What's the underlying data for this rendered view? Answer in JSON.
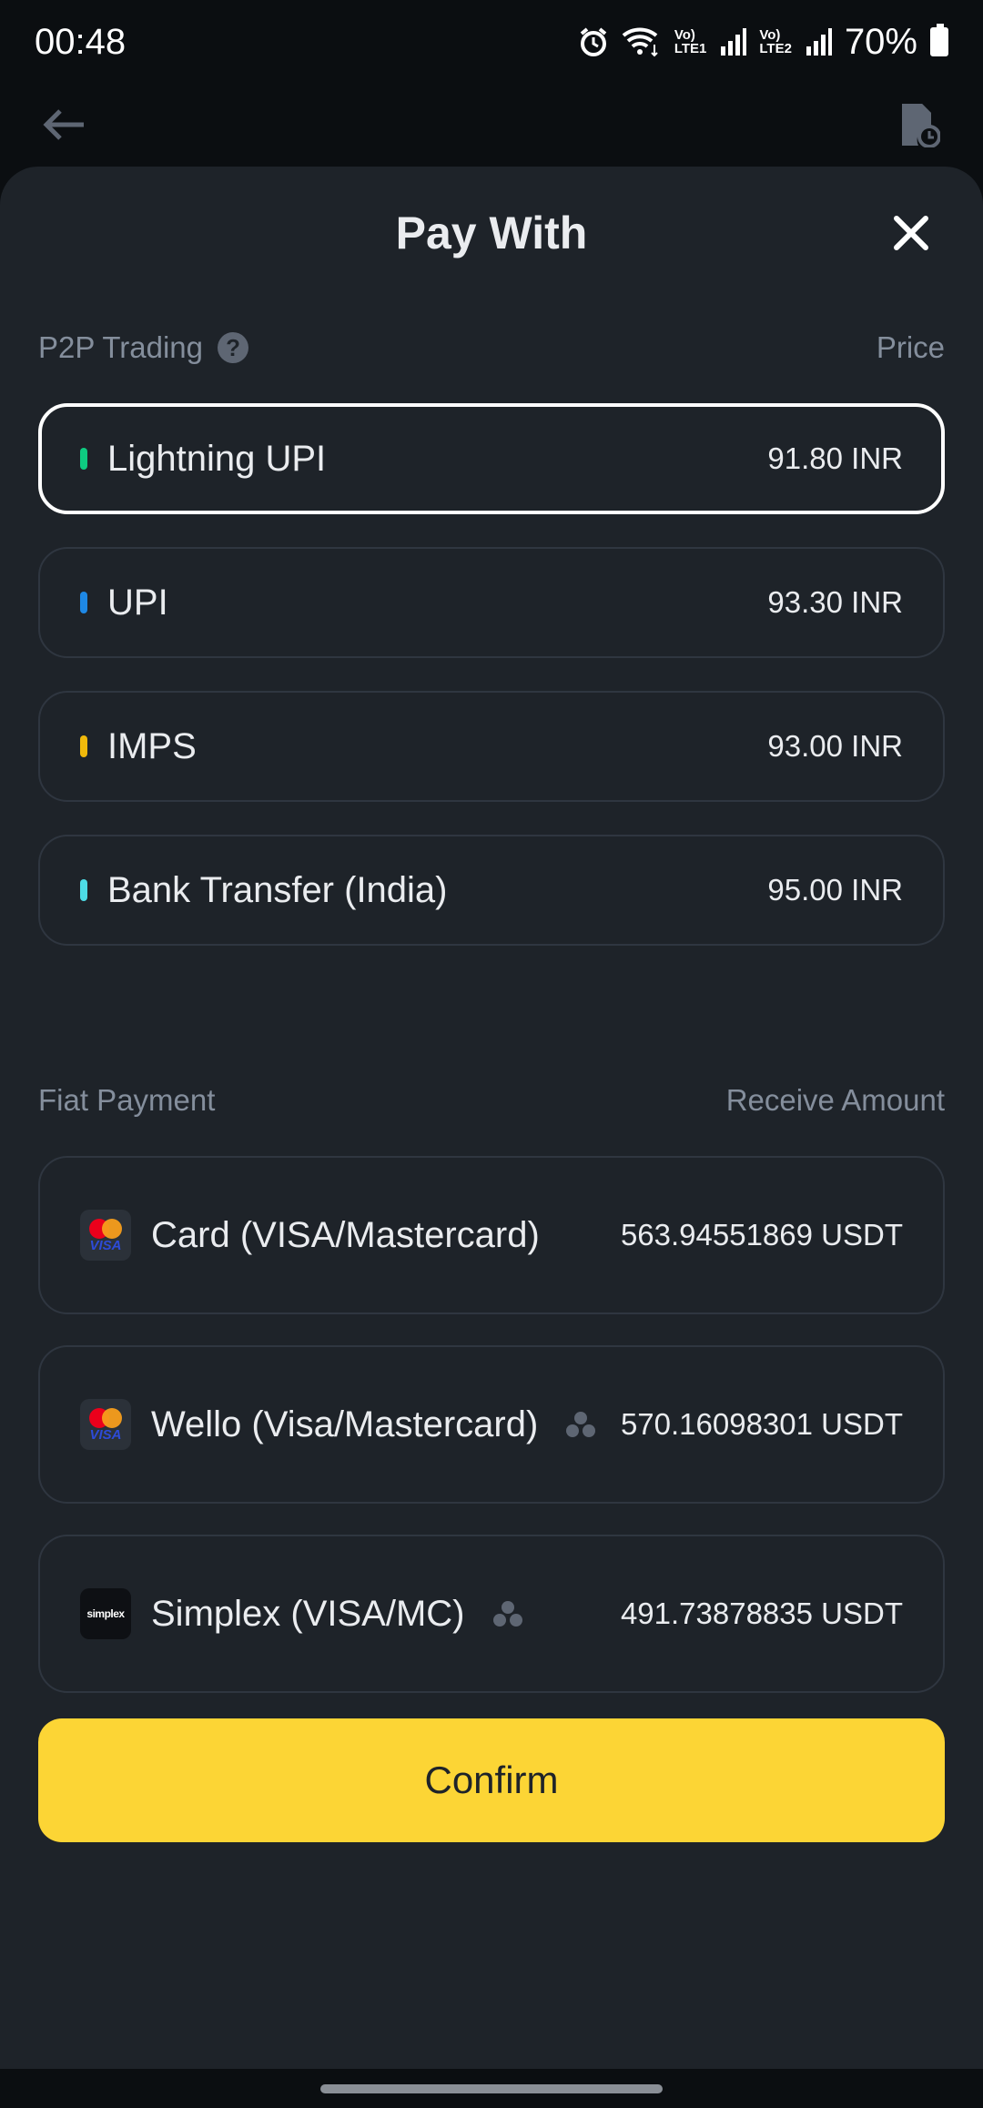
{
  "status_bar": {
    "time": "00:48",
    "net1": "Vo)\nLTE1",
    "net2": "Vo)\nLTE2",
    "battery": "70%",
    "icons": [
      "alarm-icon",
      "wifi-icon",
      "signal-icon",
      "battery-icon"
    ]
  },
  "sheet": {
    "title": "Pay With"
  },
  "p2p": {
    "label": "P2P Trading",
    "column_label": "Price",
    "options": [
      {
        "name": "Lightning UPI",
        "value": "91.80 INR",
        "color": "#0ecb81",
        "selected": true
      },
      {
        "name": "UPI",
        "value": "93.30 INR",
        "color": "#1e88e5",
        "selected": false
      },
      {
        "name": "IMPS",
        "value": "93.00 INR",
        "color": "#f0b90b",
        "selected": false
      },
      {
        "name": "Bank Transfer (India)",
        "value": "95.00 INR",
        "color": "#4ddce6",
        "selected": false
      }
    ]
  },
  "fiat": {
    "label": "Fiat Payment",
    "column_label": "Receive Amount",
    "options": [
      {
        "name": "Card (VISA/Mastercard)",
        "value": "563.94551869 USDT",
        "logo": "visa-mastercard"
      },
      {
        "name": "Wello (Visa/Mastercard)",
        "value": "570.16098301 USDT",
        "logo": "visa-mastercard"
      },
      {
        "name": "Simplex (VISA/MC)",
        "value": "491.73878835 USDT",
        "logo": "simplex",
        "logo_text": "simplex"
      }
    ],
    "visa_text": "VISA"
  },
  "confirm_label": "Confirm",
  "colors": {
    "accent": "#fcd535",
    "sheet_bg": "#1e2329",
    "border": "#2f3640"
  }
}
